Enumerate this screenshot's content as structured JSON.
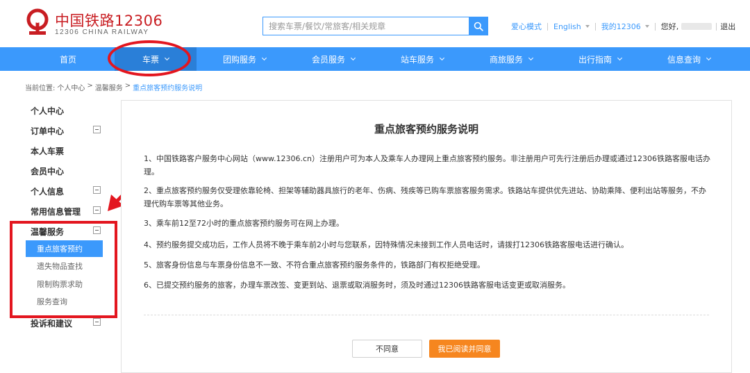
{
  "header": {
    "logo_cn": "中国铁路12306",
    "logo_en": "12306 CHINA RAILWAY",
    "search_placeholder": "搜索车票/餐饮/常旅客/相关规章",
    "links": {
      "care_mode": "爱心模式",
      "language": "English",
      "my12306": "我的12306",
      "greeting": "您好,",
      "logout": "退出"
    }
  },
  "nav": {
    "items": [
      "首页",
      "车票",
      "团购服务",
      "会员服务",
      "站车服务",
      "商旅服务",
      "出行指南",
      "信息查询"
    ],
    "active_index": 1
  },
  "breadcrumb": {
    "prefix": "当前位置:",
    "items": [
      "个人中心",
      "温馨服务",
      "重点旅客预约服务说明"
    ],
    "separator": ">"
  },
  "sidebar": {
    "items": [
      "个人中心",
      "订单中心",
      "本人车票",
      "会员中心",
      "个人信息",
      "常用信息管理",
      "温馨服务",
      "投诉和建议"
    ],
    "sub_items": [
      "重点旅客预约",
      "遗失物品查找",
      "限制购票求助",
      "服务查询"
    ],
    "active_sub_index": 0
  },
  "content": {
    "title": "重点旅客预约服务说明",
    "paragraphs": [
      "1、中国铁路客户服务中心网站（www.12306.cn）注册用户可为本人及乘车人办理网上重点旅客预约服务。非注册用户可先行注册后办理或通过12306铁路客服电话办理。",
      "2、重点旅客预约服务仅受理依靠轮椅、担架等辅助器具旅行的老年、伤病、残疾等已购车票旅客服务需求。铁路站车提供优先进站、协助乘降、便利出站等服务，不办理代购车票等其他业务。",
      "3、乘车前12至72小时的重点旅客预约服务可在网上办理。",
      "4、预约服务提交成功后，工作人员将不晚于乘车前2小时与您联系，因特殊情况未接到工作人员电话时，请拨打12306铁路客服电话进行确认。",
      "5、旅客身份信息与车票身份信息不一致、不符合重点旅客预约服务条件的，铁路部门有权拒绝受理。",
      "6、已提交预约服务的旅客，办理车票改签、变更到站、退票或取消服务时，须及时通过12306铁路客服电话变更或取消服务。"
    ],
    "disagree_label": "不同意",
    "agree_label": "我已阅读并同意"
  },
  "colors": {
    "primary_blue": "#3b99fc",
    "brand_red": "#c81d22",
    "annotation_red": "#e3161f",
    "agree_orange": "#f6861f"
  }
}
